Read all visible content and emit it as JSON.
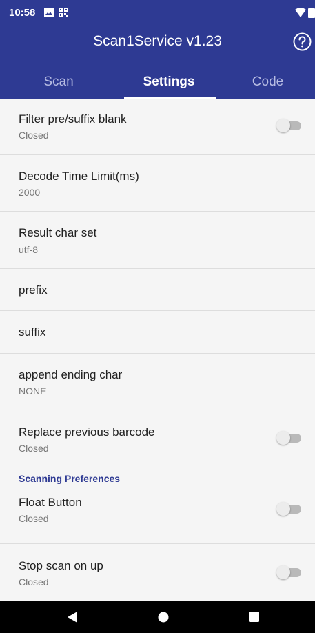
{
  "status_bar": {
    "time": "10:58",
    "icons_left": [
      "image-icon",
      "qr-grid-icon"
    ],
    "icons_right": [
      "wifi-icon",
      "battery-icon"
    ]
  },
  "app": {
    "title": "Scan1Service v1.23",
    "help_icon": "help-circle-icon",
    "primary_color": "#2e3a93"
  },
  "tabs": [
    {
      "label": "Scan",
      "selected": false
    },
    {
      "label": "Settings",
      "selected": true
    },
    {
      "label": "Code",
      "selected": false
    }
  ],
  "settings": [
    {
      "title": "Filter pre/suffix blank",
      "subtitle": "Closed",
      "toggle": false
    },
    {
      "title": "Decode Time Limit(ms)",
      "subtitle": "2000"
    },
    {
      "title": "Result char set",
      "subtitle": "utf-8"
    },
    {
      "title": "prefix"
    },
    {
      "title": "suffix"
    },
    {
      "title": "append ending char",
      "subtitle": "NONE"
    },
    {
      "title": "Replace previous barcode",
      "subtitle": "Closed",
      "toggle": false
    }
  ],
  "section": {
    "label": "Scanning Preferences"
  },
  "preferences": [
    {
      "title": "Float Button",
      "subtitle": "Closed",
      "toggle": false
    },
    {
      "title": "Stop scan on up",
      "subtitle": "Closed",
      "toggle": false
    }
  ],
  "nav": {
    "buttons": [
      "back-icon",
      "home-icon",
      "recents-icon"
    ]
  }
}
